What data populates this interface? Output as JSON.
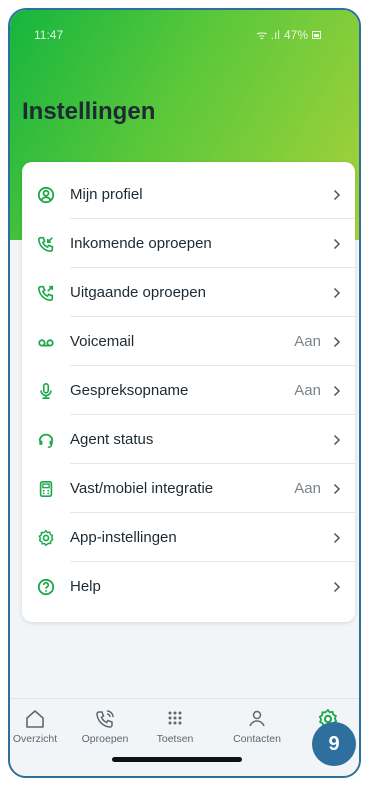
{
  "status_bar": {
    "time": "11:47",
    "signal": "ᯤ .ıl",
    "battery": "47%"
  },
  "header": {
    "title": "Instellingen"
  },
  "settings": {
    "items": [
      {
        "label": "Mijn profiel",
        "value": "",
        "icon": "user-circle-icon"
      },
      {
        "label": "Inkomende oproepen",
        "value": "",
        "icon": "phone-incoming-icon"
      },
      {
        "label": "Uitgaande oproepen",
        "value": "",
        "icon": "phone-outgoing-icon"
      },
      {
        "label": "Voicemail",
        "value": "Aan",
        "icon": "voicemail-icon"
      },
      {
        "label": "Gespreksopname",
        "value": "Aan",
        "icon": "microphone-icon"
      },
      {
        "label": "Agent status",
        "value": "",
        "icon": "headset-icon"
      },
      {
        "label": "Vast/mobiel integratie",
        "value": "Aan",
        "icon": "deskphone-icon"
      },
      {
        "label": "App-instellingen",
        "value": "",
        "icon": "gear-icon"
      },
      {
        "label": "Help",
        "value": "",
        "icon": "help-circle-icon"
      }
    ]
  },
  "tabbar": {
    "tabs": [
      {
        "label": "Overzicht",
        "icon": "home-icon",
        "active": false
      },
      {
        "label": "Oproepen",
        "icon": "phone-calls-icon",
        "active": false
      },
      {
        "label": "Toetsen",
        "icon": "keypad-icon",
        "active": false
      },
      {
        "label": "Contacten",
        "icon": "contacts-icon",
        "active": false
      },
      {
        "label": "",
        "icon": "settings-gear-icon",
        "active": true
      }
    ]
  },
  "step_badge": "9",
  "colors": {
    "green": "#1aa84a",
    "gradient_start": "#15b53f",
    "gradient_end": "#a8d23a",
    "frame_blue": "#2e6f9e"
  }
}
